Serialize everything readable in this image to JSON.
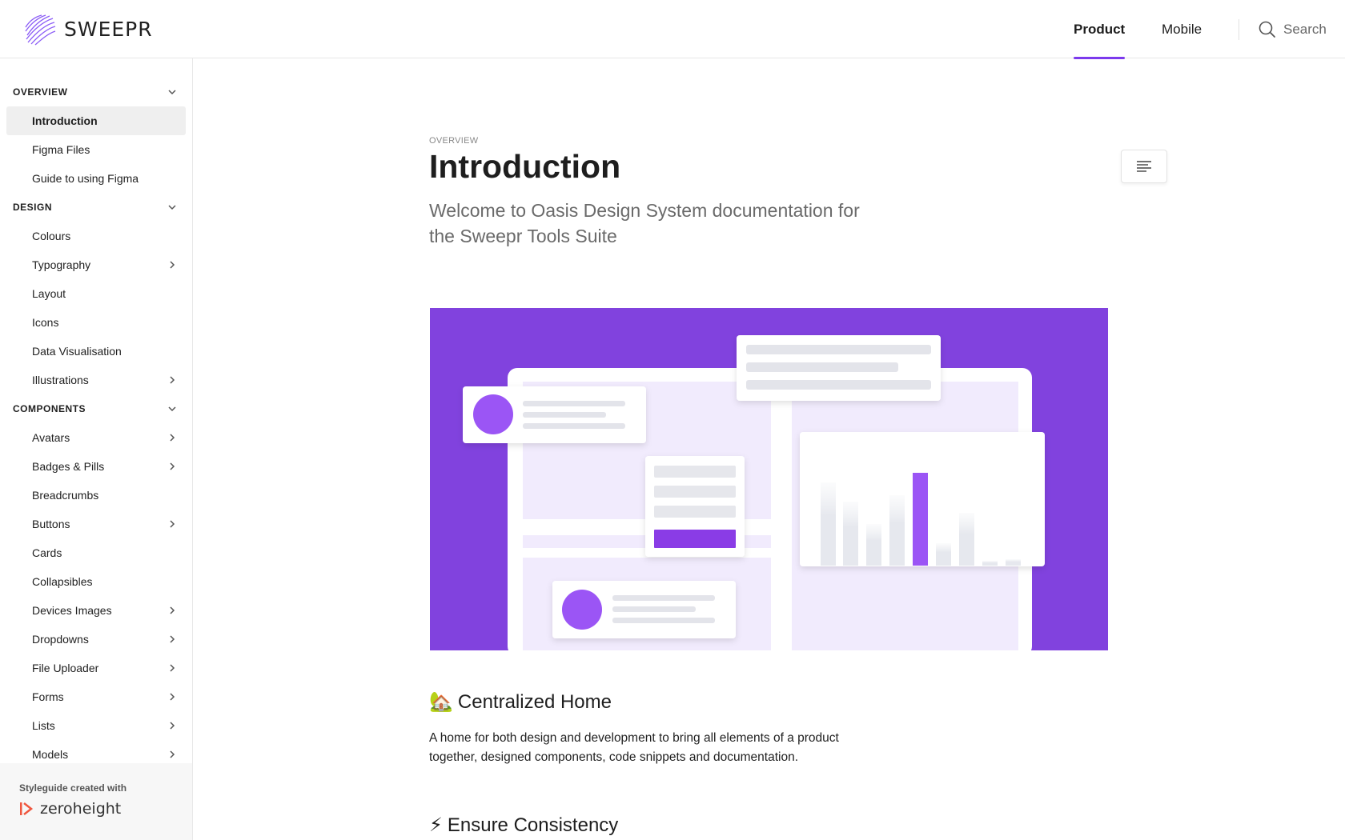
{
  "brand": {
    "name": "SWEEPR",
    "accent": "#7c3aed"
  },
  "header": {
    "tabs": [
      {
        "label": "Product",
        "active": true
      },
      {
        "label": "Mobile",
        "active": false
      }
    ],
    "search_label": "Search"
  },
  "sidebar": {
    "groups": [
      {
        "label": "OVERVIEW",
        "expanded": true
      },
      {
        "label": "DESIGN",
        "expanded": true
      },
      {
        "label": "COMPONENTS",
        "expanded": true
      }
    ],
    "overview_items": [
      {
        "label": "Introduction",
        "active": true
      },
      {
        "label": "Figma Files"
      },
      {
        "label": "Guide to using Figma"
      }
    ],
    "design_items": [
      {
        "label": "Colours"
      },
      {
        "label": "Typography",
        "has_children": true
      },
      {
        "label": "Layout"
      },
      {
        "label": "Icons"
      },
      {
        "label": "Data Visualisation"
      },
      {
        "label": "Illustrations",
        "has_children": true
      }
    ],
    "component_items": [
      {
        "label": "Avatars",
        "has_children": true
      },
      {
        "label": "Badges & Pills",
        "has_children": true
      },
      {
        "label": "Breadcrumbs"
      },
      {
        "label": "Buttons",
        "has_children": true
      },
      {
        "label": "Cards"
      },
      {
        "label": "Collapsibles"
      },
      {
        "label": "Devices Images",
        "has_children": true
      },
      {
        "label": "Dropdowns",
        "has_children": true
      },
      {
        "label": "File Uploader",
        "has_children": true
      },
      {
        "label": "Forms",
        "has_children": true
      },
      {
        "label": "Lists",
        "has_children": true
      },
      {
        "label": "Models",
        "has_children": true
      }
    ],
    "footer": {
      "label": "Styleguide created with",
      "brand": "zeroheight"
    }
  },
  "page": {
    "eyebrow": "OVERVIEW",
    "title": "Introduction",
    "subtitle": "Welcome to Oasis Design System documentation for the Sweepr Tools Suite",
    "sections": [
      {
        "emoji": "🏡",
        "heading": "Centralized Home",
        "body": "A home for both design and development to bring all elements of a product together, designed components, code snippets and documentation."
      },
      {
        "emoji": "⚡",
        "heading": "Ensure Consistency"
      }
    ]
  }
}
